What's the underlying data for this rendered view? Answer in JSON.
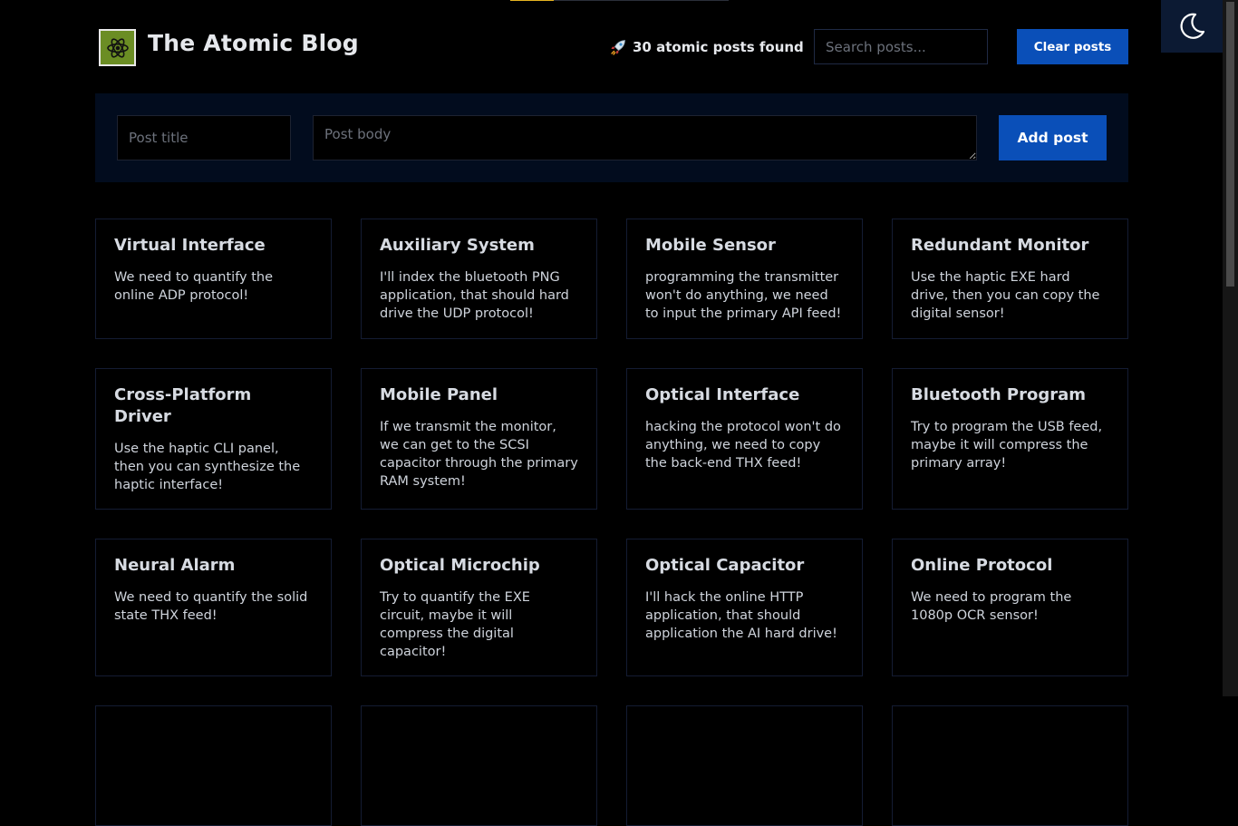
{
  "app": {
    "title": "The Atomic Blog",
    "logo_icon": "atom-icon",
    "theme_toggle_icon": "moon-icon"
  },
  "header": {
    "status_icon": "rocket-icon",
    "posts_found": "30 atomic posts found",
    "search_placeholder": "Search posts...",
    "clear_label": "Clear posts"
  },
  "form": {
    "title_placeholder": "Post title",
    "body_placeholder": "Post body",
    "add_label": "Add post"
  },
  "posts": [
    {
      "title": "Virtual Interface",
      "body": "We need to quantify the online ADP protocol!"
    },
    {
      "title": "Auxiliary System",
      "body": "I'll index the bluetooth PNG application, that should hard drive the UDP protocol!"
    },
    {
      "title": "Mobile Sensor",
      "body": "programming the transmitter won't do anything, we need to input the primary API feed!"
    },
    {
      "title": "Redundant Monitor",
      "body": "Use the haptic EXE hard drive, then you can copy the digital sensor!"
    },
    {
      "title": "Cross-Platform Driver",
      "body": "Use the haptic CLI panel, then you can synthesize the haptic interface!"
    },
    {
      "title": "Mobile Panel",
      "body": "If we transmit the monitor, we can get to the SCSI capacitor through the primary RAM system!"
    },
    {
      "title": "Optical Interface",
      "body": "hacking the protocol won't do anything, we need to copy the back-end THX feed!"
    },
    {
      "title": "Bluetooth Program",
      "body": "Try to program the USB feed, maybe it will compress the primary array!"
    },
    {
      "title": "Neural Alarm",
      "body": "We need to quantify the solid state THX feed!"
    },
    {
      "title": "Optical Microchip",
      "body": "Try to quantify the EXE circuit, maybe it will compress the digital capacitor!"
    },
    {
      "title": "Optical Capacitor",
      "body": "I'll hack the online HTTP application, that should application the AI hard drive!"
    },
    {
      "title": "Online Protocol",
      "body": "We need to program the 1080p OCR sensor!"
    }
  ],
  "colors": {
    "background": "#000000",
    "accent": "#0a4fb8",
    "panel": "#020c1e",
    "logo_bg": "#6b8d24"
  }
}
